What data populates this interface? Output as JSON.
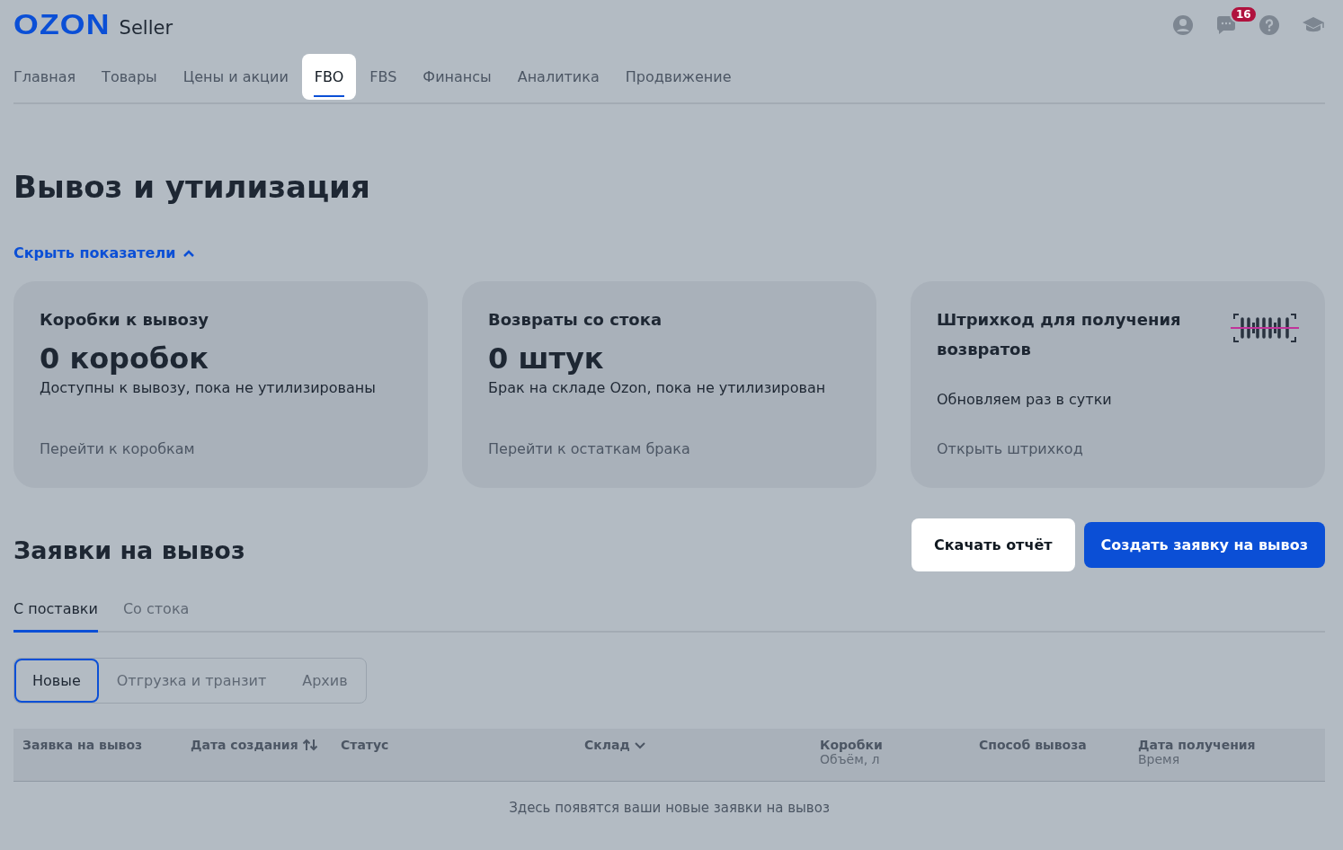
{
  "header": {
    "logo": "OZON",
    "logo_suffix": "Seller",
    "chat_badge": "16"
  },
  "nav": [
    {
      "label": "Главная",
      "selected": false
    },
    {
      "label": "Товары",
      "selected": false
    },
    {
      "label": "Цены и акции",
      "selected": false
    },
    {
      "label": "FBO",
      "selected": true
    },
    {
      "label": "FBS",
      "selected": false
    },
    {
      "label": "Финансы",
      "selected": false
    },
    {
      "label": "Аналитика",
      "selected": false
    },
    {
      "label": "Продвижение",
      "selected": false
    }
  ],
  "page_title": "Вывоз и утилизация",
  "toggle_link": "Скрыть показатели",
  "cards": [
    {
      "title": "Коробки к вывозу",
      "value": "0 коробок",
      "description": "Доступны к вывозу, пока не утилизированы",
      "link": "Перейти к коробкам",
      "kind": "stat"
    },
    {
      "title": "Возвраты со стока",
      "value": "0 штук",
      "description": "Брак на складе Ozon, пока не утилизирован",
      "link": "Перейти к остаткам брака",
      "kind": "stat"
    },
    {
      "title": "Штрихкод для получения возвратов",
      "description": "Обновляем раз в сутки",
      "link": "Открыть штрихкод",
      "kind": "barcode"
    }
  ],
  "section_title": "Заявки на вывоз",
  "buttons": {
    "download": "Скачать отчёт",
    "create": "Создать заявку на вывоз"
  },
  "tabs": [
    {
      "label": "С поставки",
      "selected": true
    },
    {
      "label": "Со стока",
      "selected": false
    }
  ],
  "segments": [
    {
      "label": "Новые",
      "selected": true
    },
    {
      "label": "Отгрузка и транзит",
      "selected": false
    },
    {
      "label": "Архив",
      "selected": false
    }
  ],
  "table": {
    "columns": [
      {
        "label": "Заявка на вывоз"
      },
      {
        "label": "Дата создания",
        "kind": "sortable"
      },
      {
        "label": "Статус"
      },
      {
        "label": "Склад",
        "kind": "filter"
      },
      {
        "label": "Коробки",
        "sub": "Объём, л"
      },
      {
        "label": "Способ вывоза"
      },
      {
        "label": "Дата получения",
        "sub": "Время"
      }
    ],
    "empty_message": "Здесь появятся ваши новые заявки на вывоз"
  }
}
